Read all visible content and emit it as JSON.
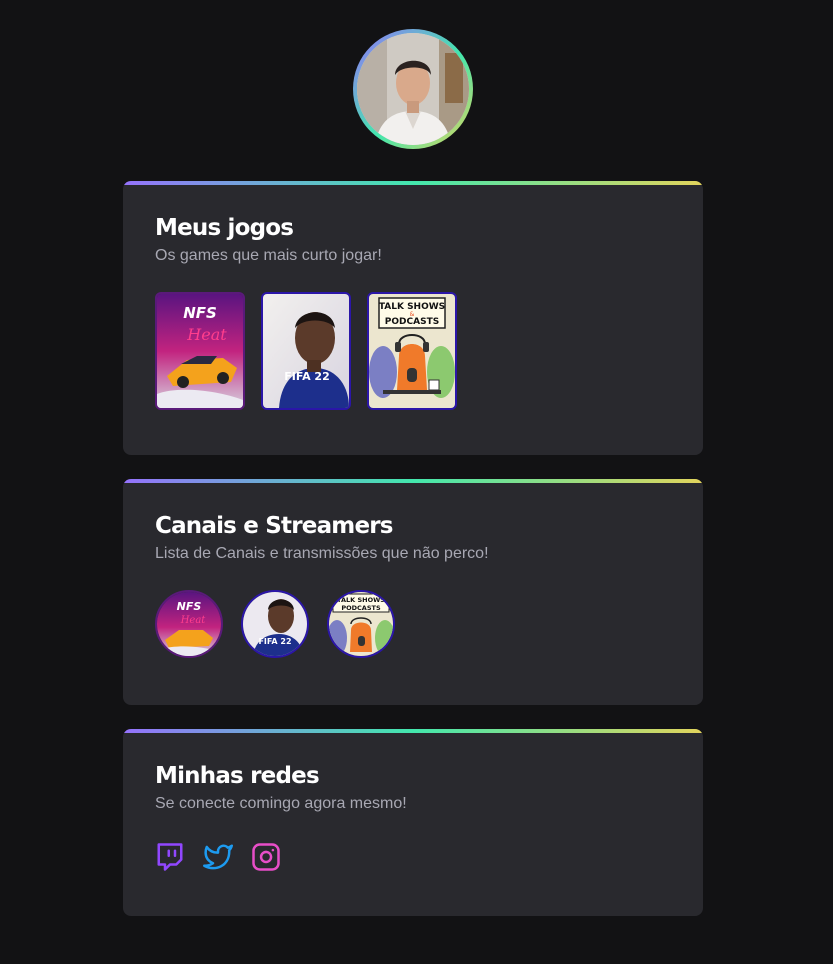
{
  "profile": {
    "avatar_icon": "profile-photo"
  },
  "games_section": {
    "title": "Meus jogos",
    "subtitle": "Os games que mais curto jogar!",
    "games": [
      {
        "name": "need-for-speed-heat-cover",
        "logo_text": "NFS",
        "sub_text": "Heat"
      },
      {
        "name": "fifa-22-cover",
        "logo_text": "FIFA 22"
      },
      {
        "name": "talk-shows-podcasts-cover",
        "line1": "TALK SHOWS",
        "line2": "&",
        "line3": "PODCASTS"
      }
    ]
  },
  "channels_section": {
    "title": "Canais e Streamers",
    "subtitle": "Lista de Canais e transmissões que não perco!",
    "channels": [
      {
        "name": "need-for-speed-heat-channel",
        "logo_text": "NFS",
        "sub_text": "Heat"
      },
      {
        "name": "fifa-22-channel",
        "logo_text": "FIFA 22"
      },
      {
        "name": "talk-shows-podcasts-channel",
        "line1": "TALK SHOWS",
        "line3": "PODCASTS"
      }
    ]
  },
  "social_section": {
    "title": "Minhas redes",
    "subtitle": "Se conecte comingo agora mesmo!",
    "links": [
      {
        "icon": "twitch-icon",
        "color": "#9147ff"
      },
      {
        "icon": "twitter-icon",
        "color": "#1d9bf0"
      },
      {
        "icon": "instagram-icon",
        "color": "#e84ec8"
      }
    ]
  },
  "colors": {
    "background": "#121214",
    "card": "#29292e",
    "gradient": [
      "#9572fc",
      "#43e7ad",
      "#e2d45c"
    ]
  }
}
